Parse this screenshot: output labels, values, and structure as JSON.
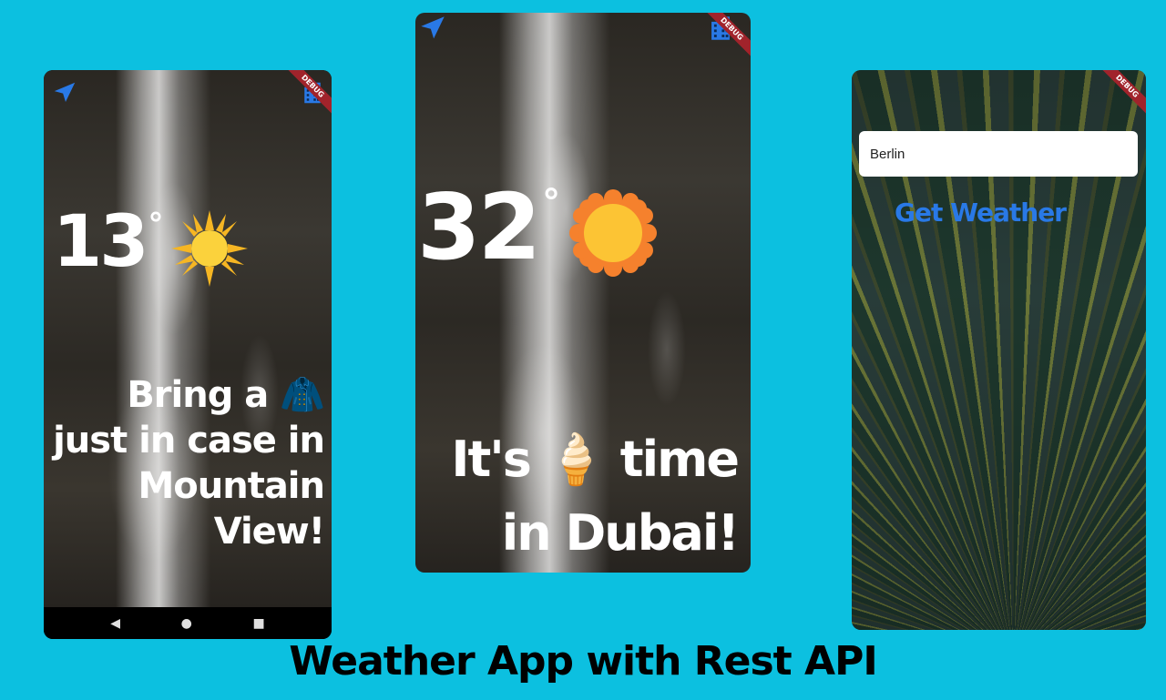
{
  "screens": [
    {
      "temperature": "13",
      "degree_symbol": "°",
      "weather_icon": "sun-icon",
      "message_line1": "Bring a 🧥",
      "message_line2": "just in case in",
      "message_line3": "Mountain",
      "message_line4": "View!",
      "nav_back": "◀",
      "nav_home": "●",
      "nav_recents": "■",
      "debug_banner": "DEBUG"
    },
    {
      "temperature": "32",
      "degree_symbol": "°",
      "weather_icon": "sun-icon",
      "message_line1": "It's 🍦 time",
      "message_line2": "in Dubai!",
      "debug_banner": "DEBUG"
    },
    {
      "city_input_value": "Berlin",
      "button_label": "Get Weather",
      "debug_banner": "DEBUG"
    }
  ],
  "caption": "Weather App with Rest API",
  "colors": {
    "background": "#0cc0e0",
    "accent_blue": "#2979e6",
    "debug_red": "#a1232b"
  }
}
